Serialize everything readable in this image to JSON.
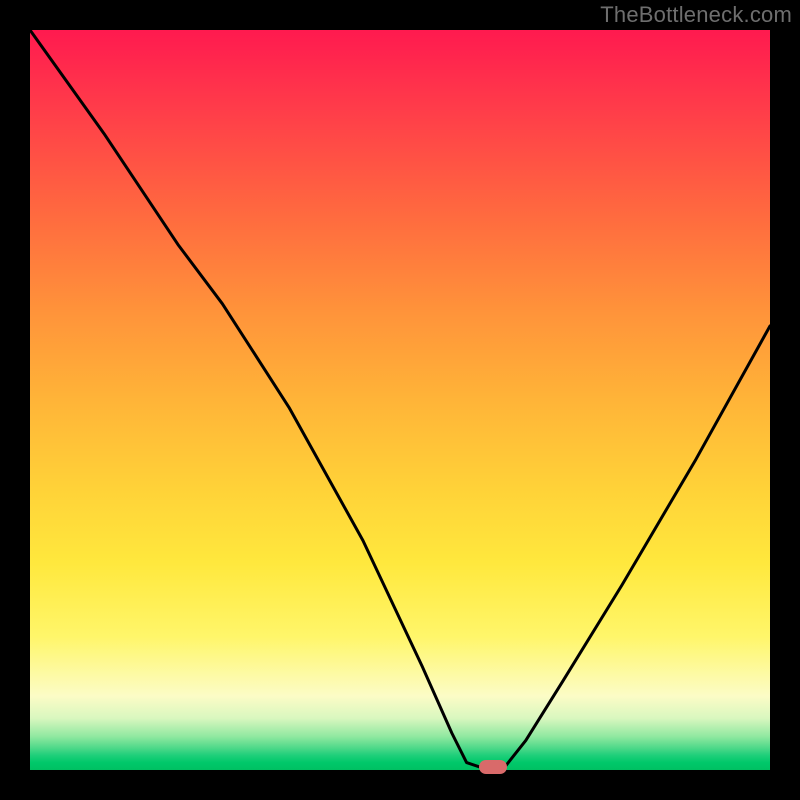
{
  "watermark": "TheBottleneck.com",
  "chart_data": {
    "type": "line",
    "title": "",
    "xlabel": "",
    "ylabel": "",
    "xlim": [
      0,
      100
    ],
    "ylim": [
      0,
      100
    ],
    "series": [
      {
        "name": "bottleneck-curve",
        "x": [
          0,
          10,
          20,
          26,
          35,
          45,
          53,
          57,
          59,
          62,
          64,
          67,
          72,
          80,
          90,
          100
        ],
        "values": [
          100,
          86,
          71,
          63,
          49,
          31,
          14,
          5,
          1,
          0,
          0.2,
          4,
          12,
          25,
          42,
          60
        ]
      }
    ],
    "marker": {
      "x": 62.5,
      "y": 0.4
    },
    "colors": {
      "curve": "#000000",
      "marker": "#d96a6a",
      "gradient_top": "#ff1a4f",
      "gradient_bottom": "#00c062"
    }
  }
}
